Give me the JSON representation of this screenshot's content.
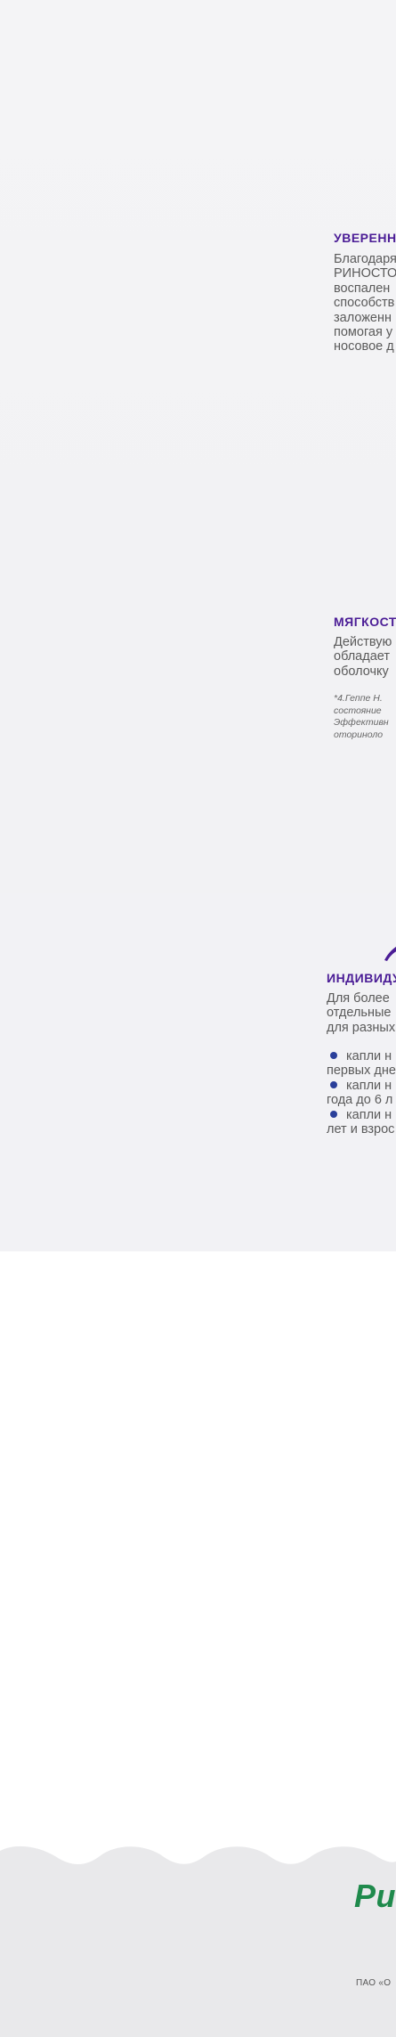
{
  "features": [
    {
      "title": "УВЕРЕНН",
      "lines": [
        "Благодаря",
        "РИНОСТО",
        "воспален",
        "способств",
        "заложенн",
        "помогая у",
        "носовое д"
      ]
    },
    {
      "title": "МЯГКОСТ",
      "lines": [
        "Действую",
        "обладает",
        "оболочку"
      ],
      "note": [
        "*4.Геппе Н.",
        "состояние",
        "Эффективн",
        "оториноло"
      ]
    },
    {
      "title": "ИНДИВИДУ",
      "lines": [
        "Для более",
        "отдельные",
        "для разных"
      ],
      "bullets": [
        {
          "first": "капли н",
          "second": "первых дне"
        },
        {
          "first": "капли н",
          "second": "года до 6 л"
        },
        {
          "first": "капли н",
          "second": "лет и взрос"
        }
      ]
    }
  ],
  "footer": {
    "logo": "Ри",
    "company": "ПАО «О"
  },
  "colors": {
    "title": "#4b1d96",
    "bullet": "#2a3f9a",
    "logo": "#1f8a4c",
    "footer_bg": "#e9e9eb"
  }
}
